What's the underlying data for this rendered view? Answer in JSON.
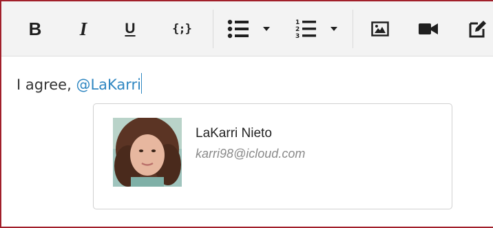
{
  "toolbar": {
    "buttons": [
      {
        "name": "bold",
        "label": "B"
      },
      {
        "name": "italic",
        "label": "I"
      },
      {
        "name": "underline",
        "label": "U"
      },
      {
        "name": "code",
        "label": "{;}"
      }
    ],
    "icons": [
      "bulleted-list-icon",
      "chevron-down-icon",
      "numbered-list-icon",
      "chevron-down-icon",
      "image-icon",
      "video-camera-icon",
      "edit-icon"
    ]
  },
  "editor": {
    "text": "I agree, ",
    "mention": "@LaKarri"
  },
  "mention_popup": {
    "suggestions": [
      {
        "name": "LaKarri Nieto",
        "email": "karri98@icloud.com"
      }
    ]
  },
  "colors": {
    "border": "#a11f2a",
    "mention": "#2e86c1",
    "toolbar_bg": "#f3f3f3"
  }
}
